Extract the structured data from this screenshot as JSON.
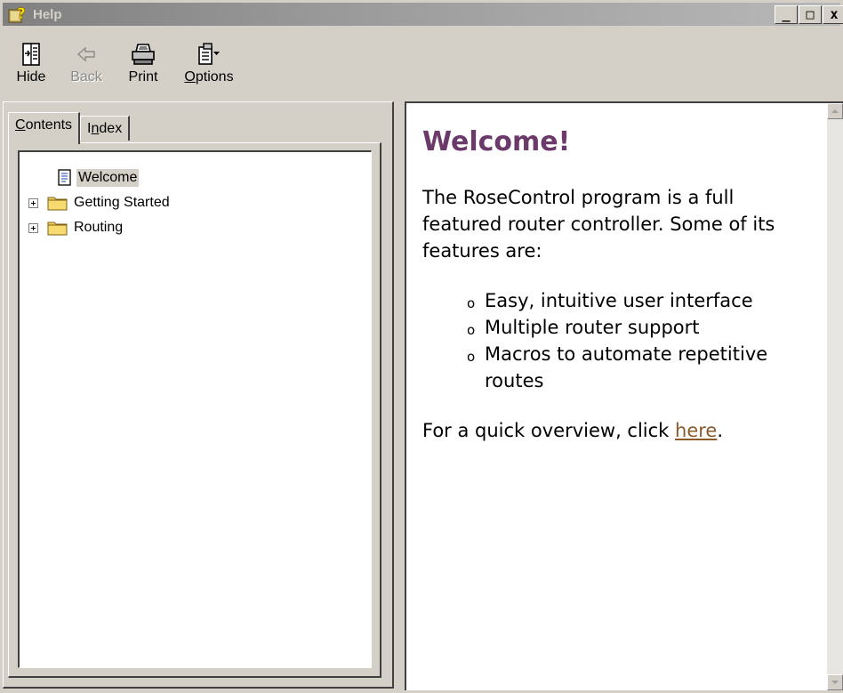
{
  "window": {
    "title": "Help",
    "controls": [
      "_",
      "□",
      "x"
    ]
  },
  "toolbar": {
    "hide_label": "Hide",
    "back_label": "Back",
    "print_label": "Print",
    "options_label": "Options"
  },
  "tabs": {
    "contents_label": "Contents",
    "index_label": "Index"
  },
  "tree": {
    "items": [
      {
        "label": "Welcome",
        "icon": "page-icon"
      },
      {
        "label": "Getting Started",
        "icon": "folder-icon"
      },
      {
        "label": "Routing",
        "icon": "folder-icon"
      }
    ]
  },
  "content": {
    "heading": "Welcome!",
    "intro": "The RoseControl program is a full featured router controller. Some of its features are:",
    "features": [
      "Easy, intuitive user interface",
      "Multiple router support",
      "Macros to automate repetitive routes"
    ],
    "overview_prefix": "For a quick overview, click ",
    "overview_link": "here",
    "overview_suffix": "."
  },
  "colors": {
    "heading": "#6b3a6b",
    "link": "#8b5a2b",
    "chrome": "#d4d0c8"
  }
}
